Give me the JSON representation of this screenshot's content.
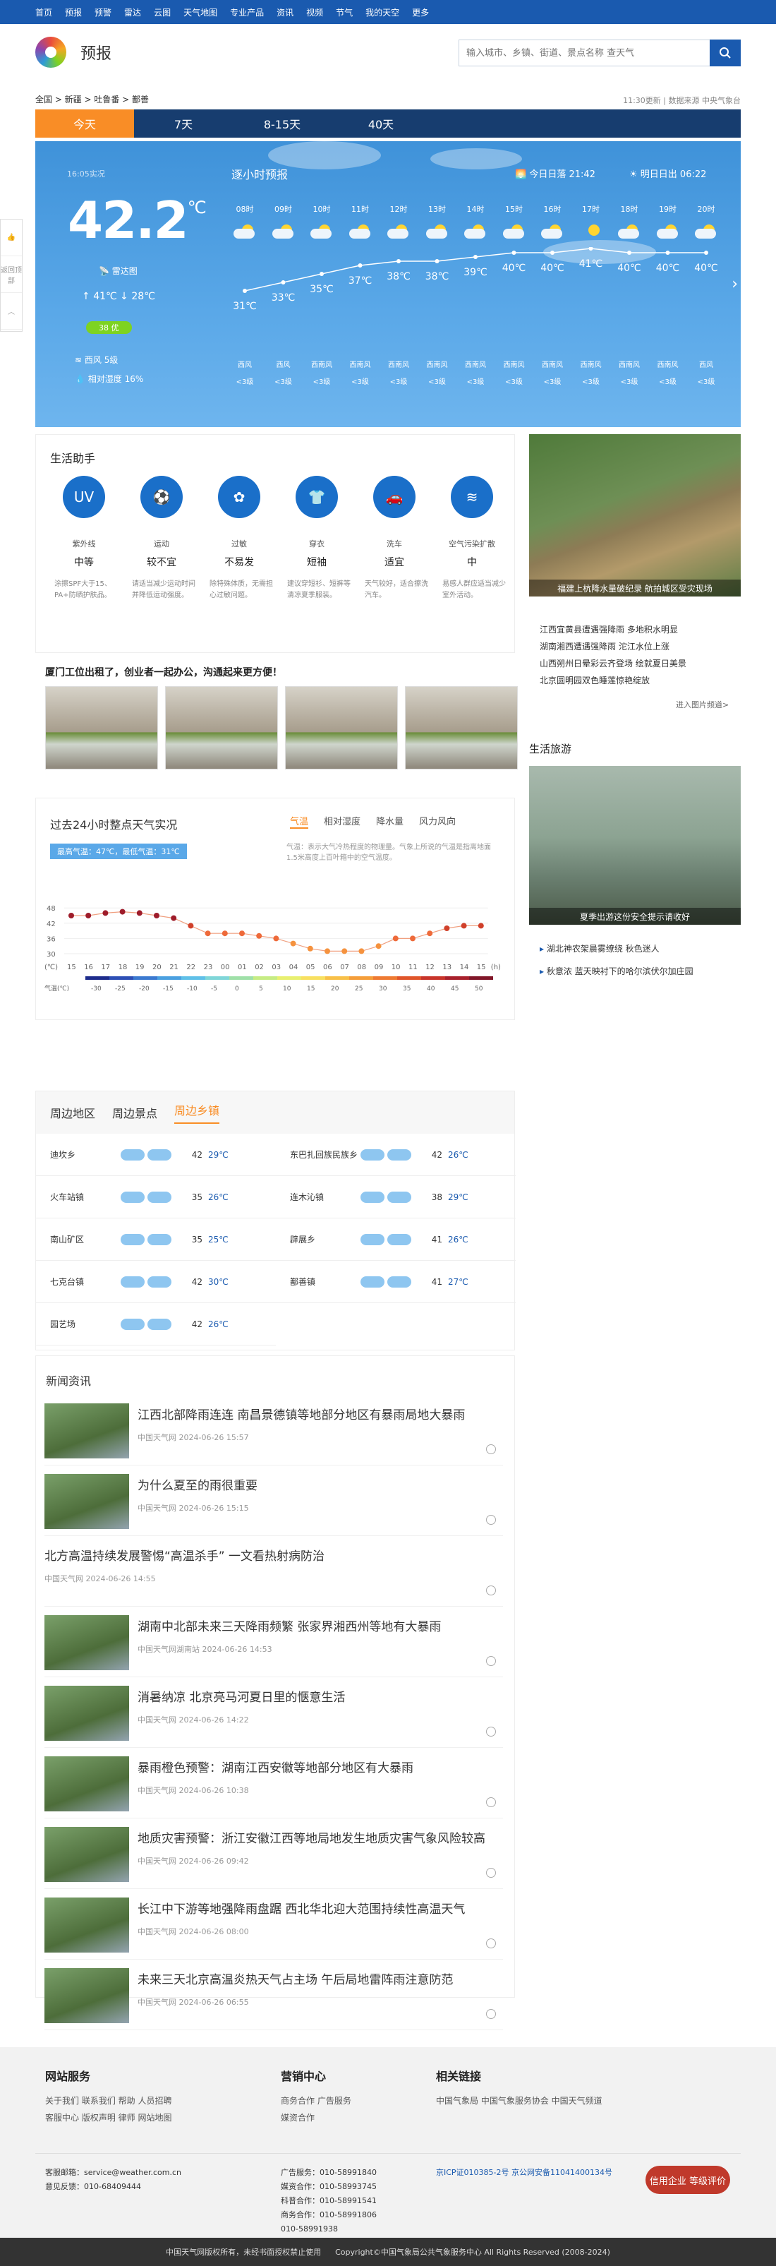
{
  "topnav": [
    "首页",
    "预报",
    "预警",
    "雷达",
    "云图",
    "天气地图",
    "专业产品",
    "资讯",
    "视频",
    "节气",
    "我的天空",
    "更多"
  ],
  "brand": "预报",
  "search": {
    "placeholder": "输入城市、乡镇、街道、景点名称 查天气"
  },
  "crumb": "全国 > 新疆 > 吐鲁番 > 鄯善",
  "update": "11:30更新 | 数据来源 中央气象台",
  "tabs": [
    "今天",
    "7天",
    "8-15天",
    "40天"
  ],
  "current": {
    "pub": "16:05实况",
    "temp": "42.2",
    "unit": "℃",
    "radar": "雷达图",
    "high": "41℃",
    "low": "28℃",
    "aqi": "38 优",
    "wind": "西风 5级",
    "humidity": "相对湿度 16%"
  },
  "hourly": {
    "title": "逐小时预报",
    "sunset": "今日日落 21:42",
    "sunrise": "明日日出 06:22",
    "hours": [
      "08时",
      "09时",
      "10时",
      "11时",
      "12时",
      "13时",
      "14时",
      "15时",
      "16时",
      "17时",
      "18时",
      "19时",
      "20时"
    ],
    "temps": [
      31,
      33,
      35,
      37,
      38,
      38,
      39,
      40,
      40,
      41,
      40,
      40,
      40
    ],
    "labels": [
      "31℃",
      "33℃",
      "35℃",
      "37℃",
      "38℃",
      "38℃",
      "39℃",
      "40℃",
      "40℃",
      "41℃",
      "40℃",
      "40℃",
      "40℃"
    ],
    "winddir": [
      "西风",
      "西风",
      "西南风",
      "西南风",
      "西南风",
      "西南风",
      "西南风",
      "西南风",
      "西南风",
      "西南风",
      "西南风",
      "西南风",
      "西风"
    ],
    "windlv": [
      "<3级",
      "<3级",
      "<3级",
      "<3级",
      "<3级",
      "<3级",
      "<3级",
      "<3级",
      "<3级",
      "<3级",
      "<3级",
      "<3级",
      "<3级"
    ],
    "sunny": [
      false,
      false,
      false,
      false,
      false,
      false,
      false,
      false,
      false,
      true,
      true,
      false,
      true
    ]
  },
  "side": [
    "返回顶部",
    "反馈",
    "收起"
  ],
  "life": {
    "title": "生活助手",
    "items": [
      {
        "icon": "UV",
        "name": "紫外线",
        "val": "中等",
        "desc": "涂擦SPF大于15、PA+防晒护肤品。"
      },
      {
        "icon": "⚽",
        "name": "运动",
        "val": "较不宜",
        "desc": "请适当减少运动时间并降低运动强度。"
      },
      {
        "icon": "✿",
        "name": "过敏",
        "val": "不易发",
        "desc": "除特殊体质，无需担心过敏问题。"
      },
      {
        "icon": "👕",
        "name": "穿衣",
        "val": "短袖",
        "desc": "建议穿短衫、短裤等清凉夏季服装。"
      },
      {
        "icon": "🚗",
        "name": "洗车",
        "val": "适宜",
        "desc": "天气较好，适合擦洗汽车。"
      },
      {
        "icon": "≋",
        "name": "空气污染扩散",
        "val": "中",
        "desc": "易感人群应适当减少室外活动。"
      }
    ]
  },
  "promo": "厦门工位出租了，创业者一起办公，沟通起来更方便！",
  "right": {
    "caption": "福建上杭降水量破纪录 航拍城区受灾现场",
    "links": [
      "江西宜黄县遭遇强降雨 多地积水明显",
      "湖南湘西遭遇强降雨 沱江水位上涨",
      "山西朔州日晕彩云齐登场 绘就夏日美景",
      "北京圆明园双色睡莲惊艳绽放"
    ],
    "more": "进入图片频道>",
    "travel": "生活旅游",
    "travel_caption": "夏季出游这份安全提示请收好",
    "travel_links": [
      "湖北神农架晨雾缭绕 秋色迷人",
      "秋意浓 蓝天映衬下的哈尔滨伏尔加庄园"
    ]
  },
  "past24": {
    "title": "过去24小时整点天气实况",
    "badge": "最高气温：47℃，最低气温：31℃",
    "tabs": [
      "气温",
      "相对湿度",
      "降水量",
      "风力风向"
    ],
    "note": "气温：表示大气冷热程度的物理量。气象上所说的气温是指离地面1.5米高度上百叶箱中的空气温度。",
    "unit": "(℃)",
    "hunit": "(h)",
    "hours": [
      "15",
      "16",
      "17",
      "18",
      "19",
      "20",
      "21",
      "22",
      "23",
      "00",
      "01",
      "02",
      "03",
      "04",
      "05",
      "06",
      "07",
      "08",
      "09",
      "10",
      "11",
      "12",
      "13",
      "14",
      "15"
    ],
    "temps": [
      45,
      45,
      46,
      46.5,
      46,
      45,
      44,
      41,
      38,
      38,
      38,
      37,
      36,
      34,
      32,
      31,
      31,
      31,
      33,
      36,
      36,
      38,
      40,
      41,
      41
    ],
    "scale": [
      "-30",
      "-25",
      "-20",
      "-15",
      "-10",
      "-5",
      "0",
      "5",
      "10",
      "15",
      "20",
      "25",
      "30",
      "35",
      "40",
      "45",
      "50"
    ],
    "scale_label": "气温(℃)",
    "yticks": [
      "48",
      "42",
      "36",
      "30"
    ]
  },
  "nearby": {
    "tabs": [
      "周边地区",
      "周边景点",
      "周边乡镇"
    ],
    "rows": [
      {
        "name": "迪坎乡",
        "hi": "42",
        "lo": "29℃"
      },
      {
        "name": "东巴扎回族民族乡",
        "hi": "42",
        "lo": "26℃"
      },
      {
        "name": "火车站镇",
        "hi": "35",
        "lo": "26℃"
      },
      {
        "name": "连木沁镇",
        "hi": "38",
        "lo": "29℃"
      },
      {
        "name": "南山矿区",
        "hi": "35",
        "lo": "25℃"
      },
      {
        "name": "辟展乡",
        "hi": "41",
        "lo": "26℃"
      },
      {
        "name": "七克台镇",
        "hi": "42",
        "lo": "30℃"
      },
      {
        "name": "鄯善镇",
        "hi": "41",
        "lo": "27℃"
      },
      {
        "name": "园艺场",
        "hi": "42",
        "lo": "26℃"
      }
    ]
  },
  "news": {
    "title": "新闻资讯",
    "items": [
      {
        "title": "江西北部降雨连连 南昌景德镇等地部分地区有暴雨局地大暴雨",
        "meta": "中国天气网    2024-06-26    15:57",
        "thumb": true
      },
      {
        "title": "为什么夏至的雨很重要",
        "meta": "中国天气网    2024-06-26    15:15",
        "thumb": true
      },
      {
        "title": "北方高温持续发展警惕“高温杀手” 一文看热射病防治",
        "meta": "中国天气网    2024-06-26    14:55",
        "thumb": false
      },
      {
        "title": "湖南中北部未来三天降雨频繁 张家界湘西州等地有大暴雨",
        "meta": "中国天气网湖南站    2024-06-26    14:53",
        "thumb": true
      },
      {
        "title": "消暑纳凉 北京亮马河夏日里的惬意生活",
        "meta": "中国天气网    2024-06-26    14:22",
        "thumb": true
      },
      {
        "title": "暴雨橙色预警：湖南江西安徽等地部分地区有大暴雨",
        "meta": "中国天气网    2024-06-26    10:38",
        "thumb": true
      },
      {
        "title": "地质灾害预警：浙江安徽江西等地局地发生地质灾害气象风险较高",
        "meta": "中国天气网    2024-06-26    09:42",
        "thumb": true
      },
      {
        "title": "长江中下游等地强降雨盘踞 西北华北迎大范围持续性高温天气",
        "meta": "中国天气网    2024-06-26    08:00",
        "thumb": true
      },
      {
        "title": "未来三天北京高温炎热天气占主场 午后局地雷阵雨注意防范",
        "meta": "中国天气网    2024-06-26    06:55",
        "thumb": true
      }
    ]
  },
  "footer": {
    "c1": {
      "title": "网站服务",
      "lines": [
        "关于我们  联系我们  帮助  人员招聘",
        "客服中心  版权声明  律师  网站地图"
      ]
    },
    "c2": {
      "title": "营销中心",
      "lines": [
        "商务合作  广告服务",
        "媒资合作"
      ]
    },
    "c3": {
      "title": "相关链接",
      "lines": [
        "中国气象局  中国气象服务协会  中国天气频道"
      ]
    },
    "contact": [
      "客服邮箱：service@weather.com.cn",
      "意见反馈：010-68409444"
    ],
    "phones": [
      "广告服务：010-58991840",
      "媒资合作：010-58993745",
      "科普合作：010-58991541",
      "商务合作：010-58991806",
      "010-58991938"
    ],
    "icp": "京ICP证010385-2号   京公网安备11041400134号",
    "credit": "信用企业 等级评价",
    "bottom": [
      "中国天气网版权所有，未经书面授权禁止使用",
      "Copyright©中国气象局公共气象服务中心 All Rights Reserved (2008-2024)"
    ]
  }
}
